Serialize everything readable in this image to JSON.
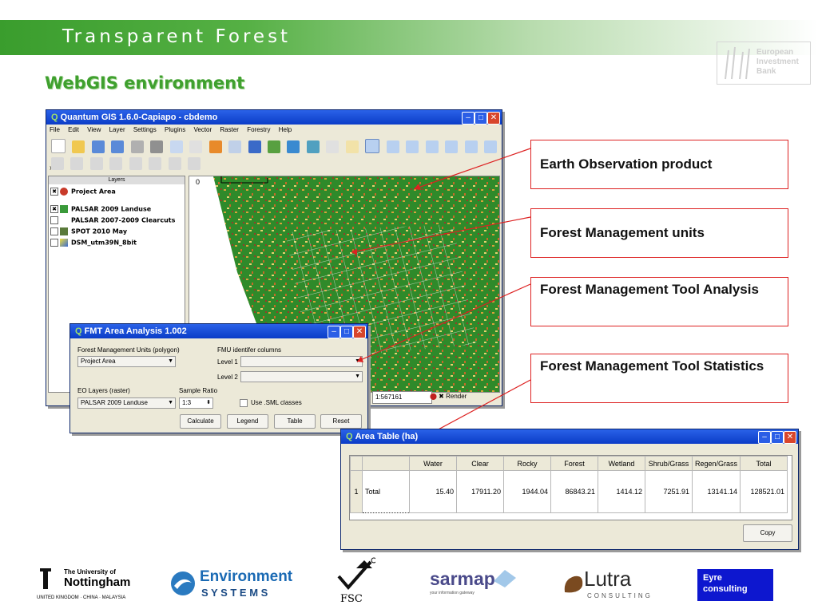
{
  "header": {
    "title": "Transparent  Forest"
  },
  "section": {
    "title": "WebGIS environment"
  },
  "eib": {
    "line1": "European",
    "line2": "Investment",
    "line3": "Bank"
  },
  "qgis": {
    "title": "Quantum GIS 1.6.0-Capiapo - cbdemo",
    "menu": [
      "File",
      "Edit",
      "View",
      "Layer",
      "Settings",
      "Plugins",
      "Vector",
      "Raster",
      "Forestry",
      "Help"
    ],
    "layers_header": "Layers",
    "layers": [
      {
        "name": "Project Area",
        "checked": "✖"
      },
      {
        "name": "PALSAR 2009 Landuse",
        "checked": "✖"
      },
      {
        "name": "PALSAR 2007-2009 Clearcuts",
        "checked": ""
      },
      {
        "name": "SPOT 2010 May",
        "checked": ""
      },
      {
        "name": "DSM_utm39N_8bit",
        "checked": ""
      }
    ],
    "scale_zero": "0",
    "scale_value": "1:567161",
    "render_label": "Render"
  },
  "fmt": {
    "title": "FMT Area Analysis 1.002",
    "fmu_label": "Forest Management Units (polygon)",
    "fmu_value": "Project Area",
    "id_columns_label": "FMU identifer columns",
    "level1_label": "Level 1",
    "level2_label": "Level 2",
    "eo_label": "EO Layers (raster)",
    "eo_value": "PALSAR 2009 Landuse",
    "sample_label": "Sample Ratio",
    "sample_value": "1:3",
    "sml_label": "Use .SML classes",
    "buttons": {
      "calculate": "Calculate",
      "legend": "Legend",
      "table": "Table",
      "reset": "Reset"
    }
  },
  "callouts": [
    "Earth Observation product",
    "Forest Management units",
    "Forest Management Tool Analysis",
    "Forest Management Tool Statistics"
  ],
  "area_table": {
    "title": "Area Table (ha)",
    "columns": [
      "Water",
      "Clear",
      "Rocky",
      "Forest",
      "Wetland",
      "Shrub/Grass",
      "Regen/Grass",
      "Total"
    ],
    "row_index": "1",
    "row_label": "Total",
    "values": [
      "15.40",
      "17911.20",
      "1944.04",
      "86843.21",
      "1414.12",
      "7251.91",
      "13141.14",
      "128521.01"
    ],
    "copy_label": "Copy"
  },
  "footer": {
    "nottingham_line1": "The University of",
    "nottingham_line2": "Nottingham",
    "nottingham_line3": "UNITED KINGDOM · CHINA · MALAYSIA",
    "env_line1": "Environment",
    "env_line2": "S Y S T E M S",
    "fsc": "FSC",
    "sarmap": "sarmap",
    "sarmap_tag": "your information gateway",
    "lutra": "Lutra",
    "lutra_tag": "CONSULTING",
    "eyre_line1": "Eyre",
    "eyre_line2": "consulting"
  },
  "colors": {
    "accent_green": "#3fa02e",
    "callout_border": "#d22222",
    "title_blue": "#0b3cc7",
    "eyre_blue": "#0d17cf"
  }
}
